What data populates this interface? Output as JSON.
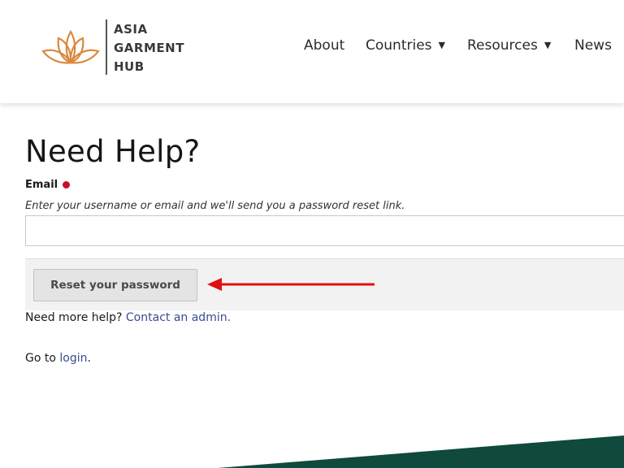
{
  "brand": {
    "lines": [
      "ASIA",
      "GARMENT",
      "HUB"
    ],
    "logo_color": "#d9893d"
  },
  "nav": {
    "items": [
      {
        "label": "About",
        "has_dropdown": false
      },
      {
        "label": "Countries",
        "has_dropdown": true
      },
      {
        "label": "Resources",
        "has_dropdown": true
      },
      {
        "label": "News",
        "has_dropdown": false
      }
    ],
    "caret": "▼"
  },
  "page": {
    "title": "Need Help?"
  },
  "form": {
    "email_label": "Email",
    "email_description": "Enter your username or email and we'll send you a password reset link.",
    "email_value": "",
    "reset_button_label": "Reset your password"
  },
  "help": {
    "prefix": "Need more help?",
    "link_text": "Contact an admin.",
    "goto_prefix": "Go to",
    "goto_link_text": "login",
    "goto_suffix": "."
  },
  "colors": {
    "required": "#c8102e",
    "annotation_arrow": "#e01010",
    "link": "#3a4d8f",
    "footer_band": "#0f4a3c"
  }
}
